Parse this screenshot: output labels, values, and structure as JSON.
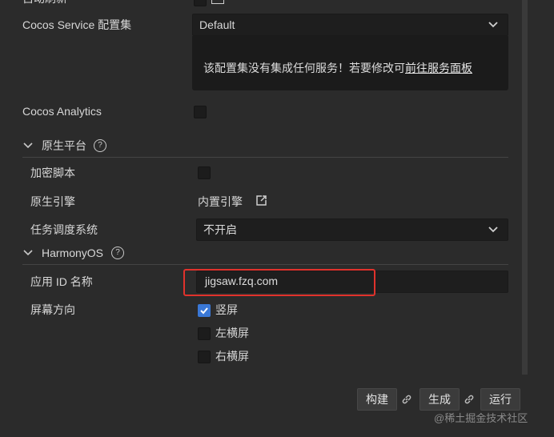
{
  "top": {
    "partial_label": "自动刷新"
  },
  "cocos_service": {
    "label": "Cocos Service 配置集",
    "selected": "Default",
    "info_text": "该配置集没有集成任何服务！若要修改可",
    "info_link": "前往服务面板"
  },
  "analytics": {
    "label": "Cocos Analytics",
    "checked": false
  },
  "native_platform": {
    "title": "原生平台",
    "encrypt_label": "加密脚本",
    "engine_label": "原生引擎",
    "engine_value": "内置引擎",
    "scheduler_label": "任务调度系统",
    "scheduler_value": "不开启"
  },
  "harmony": {
    "title": "HarmonyOS",
    "app_id_label": "应用 ID 名称",
    "app_id_value": "jigsaw.fzq.com",
    "orientation_label": "屏幕方向",
    "options": [
      {
        "label": "竖屏",
        "checked": true
      },
      {
        "label": "左横屏",
        "checked": false
      },
      {
        "label": "右横屏",
        "checked": false
      }
    ]
  },
  "actions": {
    "build": "构建",
    "make": "生成",
    "run": "运行"
  },
  "watermark": "@稀土掘金技术社区",
  "colors": {
    "background": "#2b2b2b",
    "input": "#1e1e1e",
    "highlight_border": "#e0322c",
    "checked": "#3a78d6",
    "link": "#e6e6e6"
  }
}
